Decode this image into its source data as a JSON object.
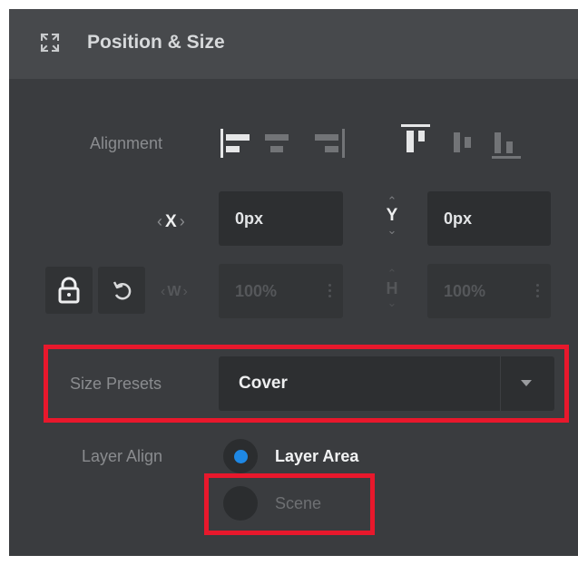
{
  "header": {
    "title": "Position & Size",
    "icon": "expand-arrows-icon"
  },
  "alignment": {
    "label": "Alignment",
    "horizontal": [
      "align-left",
      "align-center-horizontal",
      "align-right"
    ],
    "vertical": [
      "align-top",
      "align-center-vertical",
      "align-bottom"
    ],
    "selected_horizontal": "align-left",
    "selected_vertical": "align-top"
  },
  "position": {
    "x_label": "X",
    "x_value": "0px",
    "y_label": "Y",
    "y_value": "0px"
  },
  "size": {
    "w_label": "W",
    "w_value": "100%",
    "h_label": "H",
    "h_value": "100%",
    "lock_icon": "lock-icon",
    "reset_icon": "reset-icon"
  },
  "size_presets": {
    "label": "Size Presets",
    "value": "Cover"
  },
  "layer_align": {
    "label": "Layer Align",
    "options": [
      {
        "label": "Layer Area",
        "selected": true
      },
      {
        "label": "Scene",
        "selected": false
      }
    ]
  },
  "colors": {
    "panel_bg": "#3a3c3f",
    "header_bg": "#47494c",
    "accent": "#1e88e5",
    "highlight": "#e8182c"
  }
}
